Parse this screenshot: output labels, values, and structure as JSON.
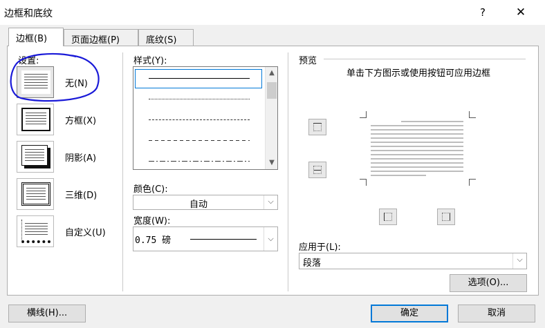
{
  "window": {
    "title": "边框和底纹",
    "help": "?",
    "close": "✕"
  },
  "tabs": [
    {
      "label": "边框(B)",
      "active": true
    },
    {
      "label": "页面边框(P)",
      "active": false
    },
    {
      "label": "底纹(S)",
      "active": false
    }
  ],
  "settings": {
    "heading": "设置:",
    "items": [
      {
        "label": "无(N)",
        "selected": true
      },
      {
        "label": "方框(X)",
        "selected": false
      },
      {
        "label": "阴影(A)",
        "selected": false
      },
      {
        "label": "三维(D)",
        "selected": false
      },
      {
        "label": "自定义(U)",
        "selected": false
      }
    ]
  },
  "style": {
    "heading": "样式(Y):",
    "options": [
      "solid",
      "dotted",
      "dash-small",
      "dashed",
      "dash-dot"
    ],
    "selected": "solid"
  },
  "color": {
    "label": "颜色(C):",
    "value": "自动"
  },
  "width": {
    "label": "宽度(W):",
    "value": "0.75 磅"
  },
  "preview": {
    "heading": "预览",
    "hint": "单击下方图示或使用按钮可应用边框"
  },
  "apply_to": {
    "label": "应用于(L):",
    "value": "段落"
  },
  "buttons": {
    "options": "选项(O)...",
    "horizontal_line": "横线(H)...",
    "ok": "确定",
    "cancel": "取消"
  },
  "colors": {
    "accent": "#0078d7",
    "annotation": "#1a1ad8"
  }
}
